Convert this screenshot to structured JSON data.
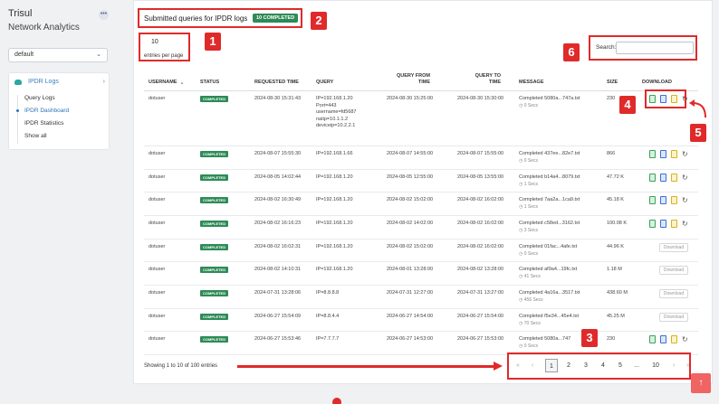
{
  "brand": {
    "title": "Trisul",
    "subtitle": "Network Analytics",
    "menu_icon": "ellipsis-icon"
  },
  "workspace": {
    "selected": "default"
  },
  "nav": {
    "section": "IPDR Logs",
    "items": [
      {
        "label": "Query Logs"
      },
      {
        "label": "IPDR Dashboard"
      },
      {
        "label": "IPDR Statistics"
      },
      {
        "label": "Show all"
      }
    ]
  },
  "main": {
    "title": "Submitted queries for IPDR logs",
    "badge": "10 COMPLETED",
    "entries_value": "10",
    "entries_label": "entries per page",
    "search_label": "Search:",
    "search_value": "",
    "columns": {
      "username": "USERNAME",
      "status": "STATUS",
      "requested_time": "REQUESTED TIME",
      "query": "QUERY",
      "query_from": "QUERY FROM TIME",
      "query_to": "QUERY TO TIME",
      "message": "MESSAGE",
      "size": "SIZE",
      "download": "DOWNLOAD"
    },
    "rows": [
      {
        "user": "dotuser",
        "status": "COMPLETED",
        "req": "2024-08-30 15:31:43",
        "query": "IP=192.168.1.20\nPort=443\nusername=fd5687\nnatip=10.1.1.2\ndeviceip=10.2.2.1",
        "from": "2024-08-30 15:25:00",
        "to": "2024-08-30 15:30:00",
        "msg": "Completed 5080a...747a.txt",
        "secs": "0 Secs",
        "size": "230"
      },
      {
        "user": "dotuser",
        "status": "COMPLETED",
        "req": "2024-08-07 15:55:30",
        "query": "IP=192.168.1.66",
        "from": "2024-08-07 14:55:00",
        "to": "2024-08-07 15:55:00",
        "msg": "Completed 437ee...82e7.txt",
        "secs": "0 Secs",
        "size": "866"
      },
      {
        "user": "dotuser",
        "status": "COMPLETED",
        "req": "2024-08-05 14:02:44",
        "query": "IP=192.168.1.20",
        "from": "2024-08-05 12:55:00",
        "to": "2024-08-05 13:55:00",
        "msg": "Completed b14a4...8079.txt",
        "secs": "1 Secs",
        "size": "47.72 K"
      },
      {
        "user": "dotuser",
        "status": "COMPLETED",
        "req": "2024-08-02 16:30:49",
        "query": "IP=192.168.1.20",
        "from": "2024-08-02 15:02:00",
        "to": "2024-08-02 16:02:00",
        "msg": "Completed 7aa2a...1ca9.txt",
        "secs": "1 Secs",
        "size": "45.18 K"
      },
      {
        "user": "dotuser",
        "status": "COMPLETED",
        "req": "2024-08-02 16:16:23",
        "query": "IP=192.168.1.20",
        "from": "2024-08-02 14:02:00",
        "to": "2024-08-02 16:02:00",
        "msg": "Completed c58ed...3162.txt",
        "secs": "3 Secs",
        "size": "100.08 K"
      },
      {
        "user": "dotuser",
        "status": "COMPLETED",
        "req": "2024-08-02 16:02:31",
        "query": "IP=192.168.1.20",
        "from": "2024-08-02 15:02:00",
        "to": "2024-08-02 16:02:00",
        "msg": "Completed 01fac...4afe.txt",
        "secs": "0 Secs",
        "size": "44.96 K"
      },
      {
        "user": "dotuser",
        "status": "COMPLETED",
        "req": "2024-08-02 14:10:31",
        "query": "IP=192.168.1.20",
        "from": "2024-08-01 13:28:00",
        "to": "2024-08-02 13:28:00",
        "msg": "Completed af9a4...19fc.txt",
        "secs": "41 Secs",
        "size": "1.18 M"
      },
      {
        "user": "dotuser",
        "status": "COMPLETED",
        "req": "2024-07-31 13:28:06",
        "query": "IP=8.8.8.8",
        "from": "2024-07-31 12:27:00",
        "to": "2024-07-31 13:27:00",
        "msg": "Completed 4a16a...3517.txt",
        "secs": "456 Secs",
        "size": "438.60 M"
      },
      {
        "user": "dotuser",
        "status": "COMPLETED",
        "req": "2024-06-27 15:54:09",
        "query": "IP=8.8.4.4",
        "from": "2024-06-27 14:54:00",
        "to": "2024-06-27 15:54:00",
        "msg": "Completed f5e34...45e4.txt",
        "secs": "70 Secs",
        "size": "45.25 M"
      },
      {
        "user": "dotuser",
        "status": "COMPLETED",
        "req": "2024-06-27 15:53:46",
        "query": "IP=7.7.7.7",
        "from": "2024-06-27 14:53:00",
        "to": "2024-06-27 15:53:00",
        "msg": "Completed 5080a...747",
        "secs": "0 Secs",
        "size": "230"
      }
    ],
    "download_label": "Download",
    "showing": "Showing 1 to 10 of 100 entries",
    "pager": [
      "«",
      "‹",
      "1",
      "2",
      "3",
      "4",
      "5",
      "...",
      "10",
      "›",
      "»"
    ]
  },
  "annotations": [
    "1",
    "2",
    "3",
    "4",
    "5",
    "6"
  ],
  "colors": {
    "accent": "#2e8b57",
    "annotation": "#e02a2a",
    "link": "#2a73b8"
  }
}
